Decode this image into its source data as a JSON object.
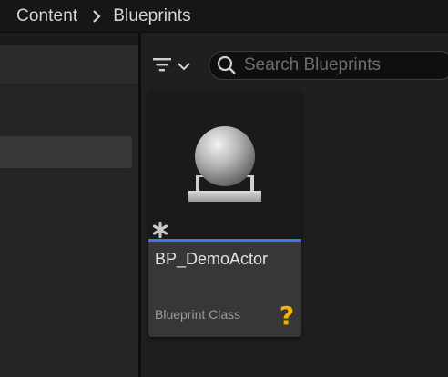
{
  "breadcrumb": {
    "items": [
      "Content",
      "Blueprints"
    ]
  },
  "toolbar": {
    "filter_icon": "filter-icon",
    "search": {
      "placeholder": "Search Blueprints",
      "value": ""
    }
  },
  "asset": {
    "name": "BP_DemoActor",
    "type": "Blueprint Class",
    "badge": "?",
    "accent_color": "#3a78e6",
    "badge_color": "#f5b400"
  }
}
